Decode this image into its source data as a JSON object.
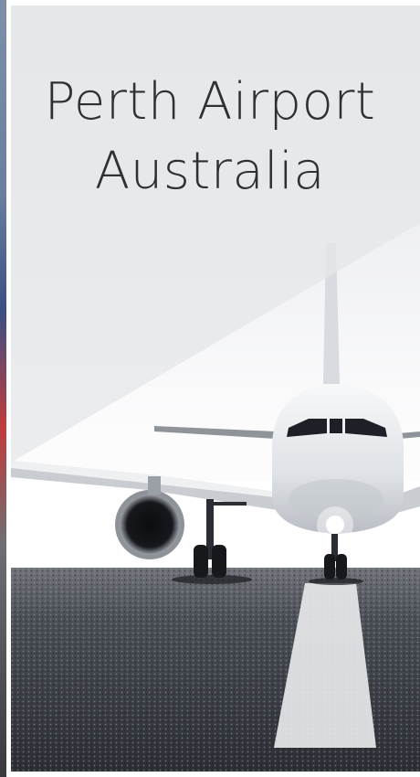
{
  "card": {
    "title_line1": "Perth Airport",
    "title_line2": "Australia"
  }
}
